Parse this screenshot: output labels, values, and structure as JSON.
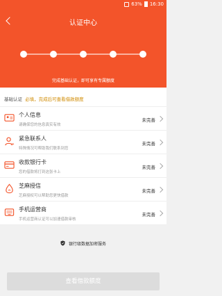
{
  "status_bar": {
    "battery": "63%",
    "time": "16:30"
  },
  "header": {
    "title": "认证中心",
    "progress_steps": 5,
    "hint": "完成基础认证，即可享有专属额度"
  },
  "section": {
    "label": "基础认证",
    "requirement": "必填，完成后可查看借款额度"
  },
  "items": [
    {
      "name": "个人信息",
      "sub": "请确保您的信息真实有效",
      "status": "未完善",
      "icon": "id-card-icon"
    },
    {
      "name": "紧急联系人",
      "sub": "特殊情况可帮助我们联系到您",
      "status": "未完善",
      "icon": "contact-person-icon"
    },
    {
      "name": "收款银行卡",
      "sub": "您的借款将打到这张卡上",
      "status": "未完善",
      "icon": "bank-card-icon"
    },
    {
      "name": "芝麻授信",
      "sub": "芝麻授权可以帮助您更快借款",
      "status": "未完善",
      "icon": "sesame-credit-icon"
    },
    {
      "name": "手机运营商",
      "sub": "手机运营商认证可以加速借款审核",
      "status": "未完善",
      "icon": "mobile-carrier-icon"
    }
  ],
  "security_note": "银行级数据加密服务",
  "submit_button": "查看借款额度",
  "colors": {
    "primary": "#f3542a",
    "required_text": "#d08a00",
    "button_disabled": "#dcdcdc"
  }
}
